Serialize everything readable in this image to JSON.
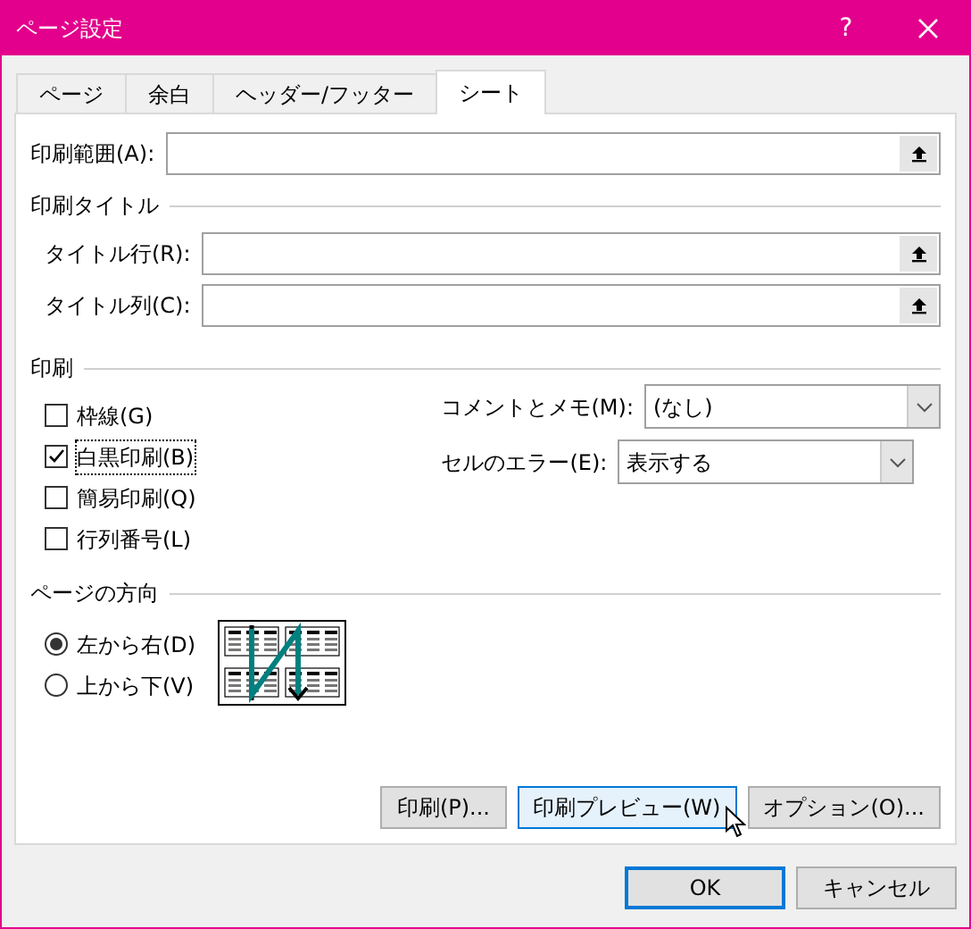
{
  "window": {
    "title": "ページ設定",
    "help": "?"
  },
  "tabs": [
    {
      "label": "ページ",
      "selected": false
    },
    {
      "label": "余白",
      "selected": false
    },
    {
      "label": "ヘッダー/フッター",
      "selected": false
    },
    {
      "label": "シート",
      "selected": true
    }
  ],
  "print_range": {
    "label": "印刷範囲(A):"
  },
  "print_titles": {
    "heading": "印刷タイトル",
    "fields": [
      {
        "label": "タイトル行(R):"
      },
      {
        "label": "タイトル列(C):"
      }
    ]
  },
  "print": {
    "heading": "印刷",
    "checkboxes": [
      {
        "label": "枠線(G)",
        "checked": false,
        "focused": false
      },
      {
        "label": "白黒印刷(B)",
        "checked": true,
        "focused": true
      },
      {
        "label": "簡易印刷(Q)",
        "checked": false,
        "focused": false
      },
      {
        "label": "行列番号(L)",
        "checked": false,
        "focused": false
      }
    ],
    "dropdowns": [
      {
        "label": "コメントとメモ(M):",
        "value": "(なし)"
      },
      {
        "label": "セルのエラー(E):",
        "value": "表示する"
      }
    ]
  },
  "page_order": {
    "heading": "ページの方向",
    "radios": [
      {
        "label": "左から右(D)",
        "selected": true
      },
      {
        "label": "上から下(V)",
        "selected": false
      }
    ]
  },
  "buttons": [
    {
      "label": "印刷(P)...",
      "hovered": false
    },
    {
      "label": "印刷プレビュー(W)",
      "hovered": true
    },
    {
      "label": "オプション(O)...",
      "hovered": false
    }
  ],
  "footer_buttons": [
    {
      "label": "OK",
      "default": true
    },
    {
      "label": "キャンセル",
      "default": false
    }
  ]
}
